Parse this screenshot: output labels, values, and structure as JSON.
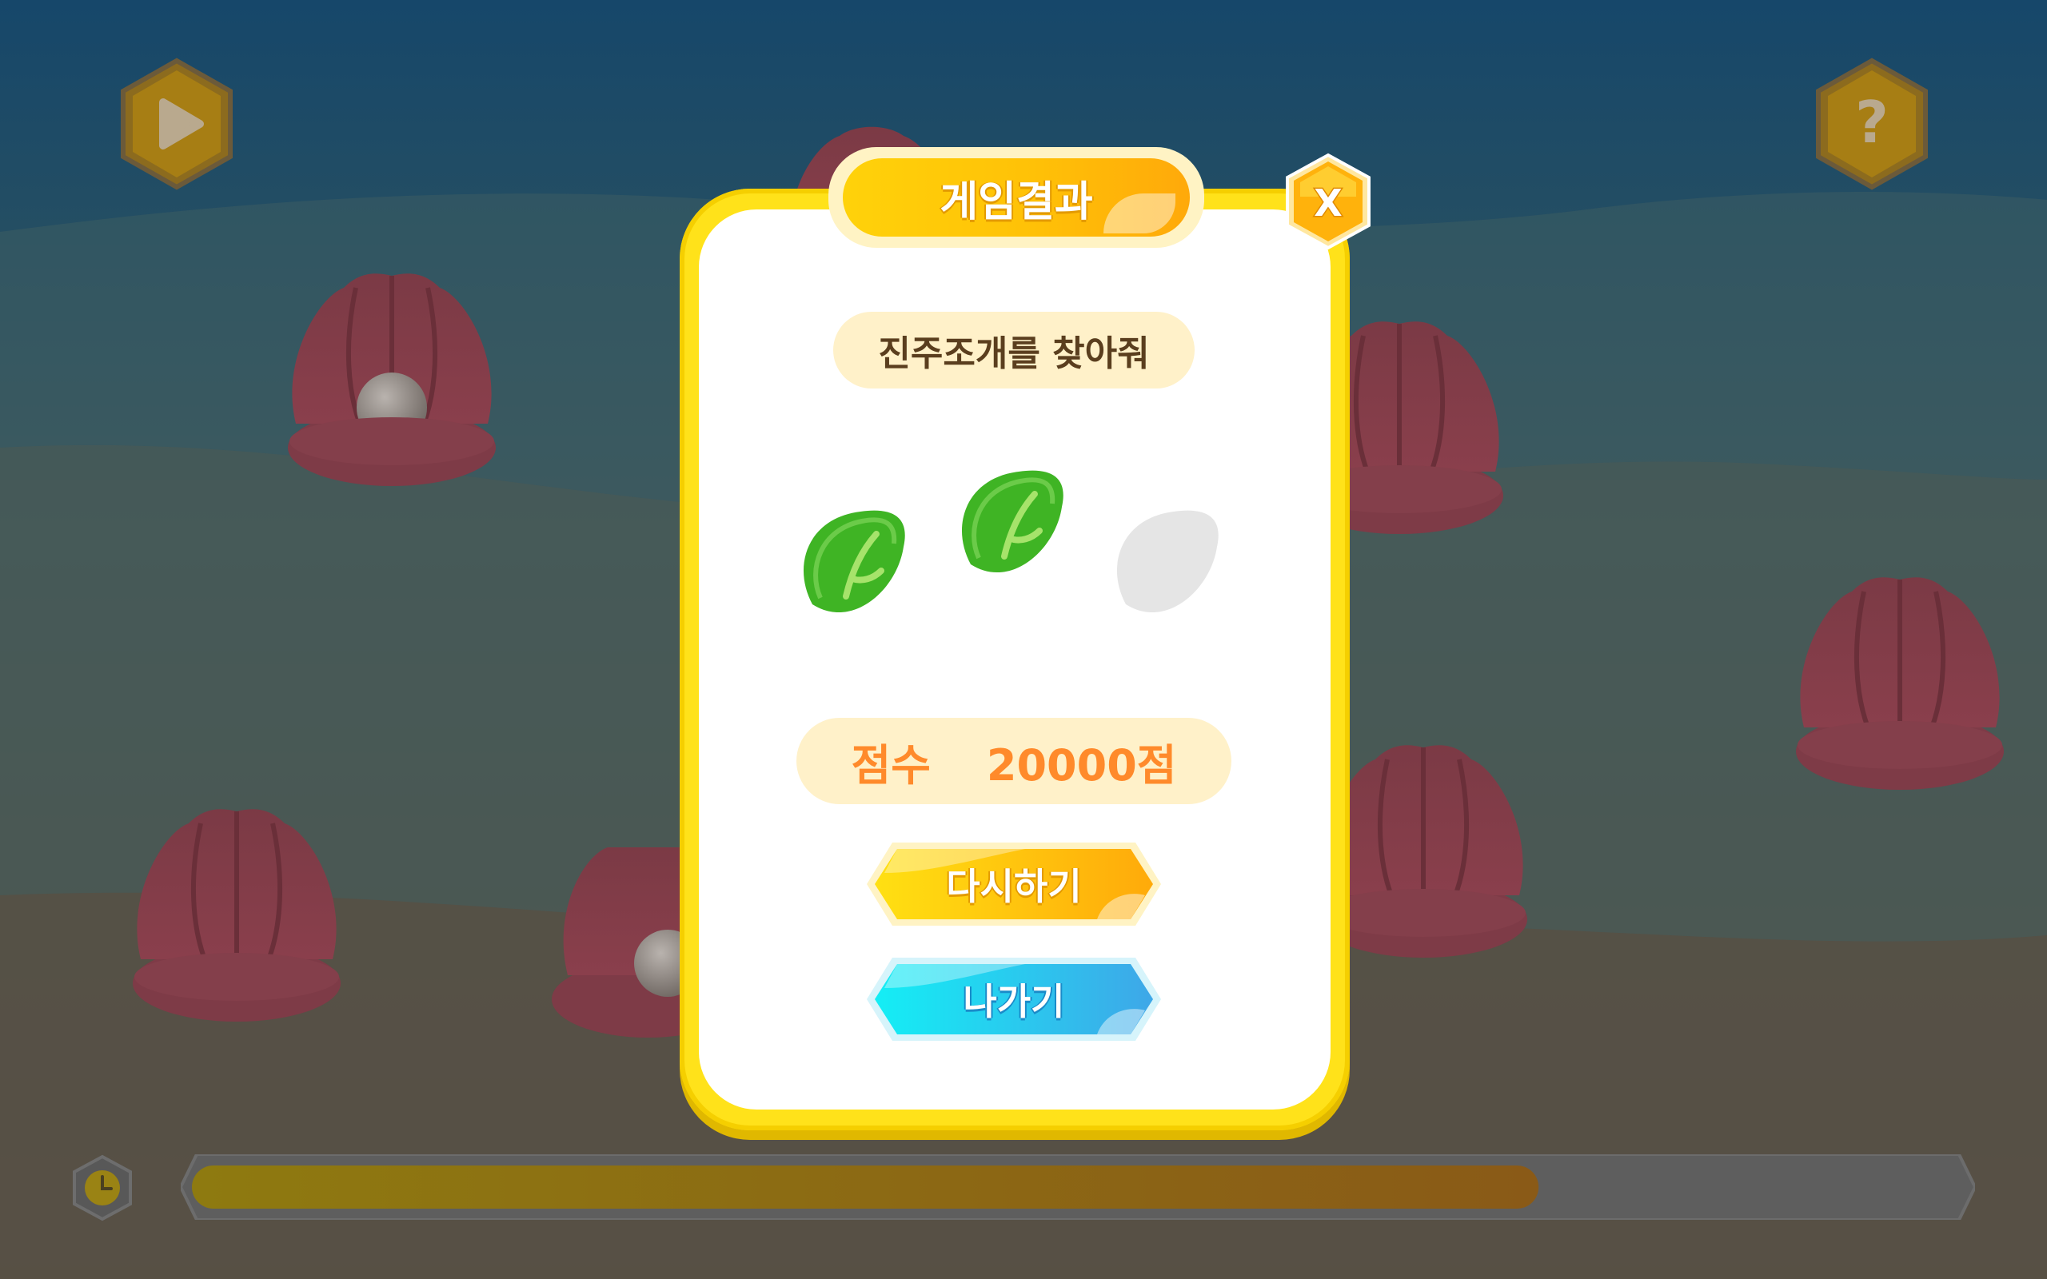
{
  "modal": {
    "title": "게임결과",
    "close_label": "X",
    "game_name": "진주조개를 찾아줘",
    "leaves": [
      {
        "state": "earned"
      },
      {
        "state": "earned"
      },
      {
        "state": "empty"
      }
    ],
    "score_label": "점수",
    "score_value": "20000점",
    "retry_label": "다시하기",
    "exit_label": "나가기"
  },
  "hud": {
    "play_icon": "play-icon",
    "help_label": "?",
    "timer_icon": "clock-icon",
    "time_progress": 0.76
  },
  "colors": {
    "accent_yellow": "#ffd20a",
    "accent_orange": "#ffa90a",
    "exit_cyan": "#14eef5",
    "exit_blue": "#3ea7e8",
    "score_text": "#ff8a2b",
    "leaf_green": "#3fb424",
    "leaf_empty": "#e5e5e5"
  }
}
